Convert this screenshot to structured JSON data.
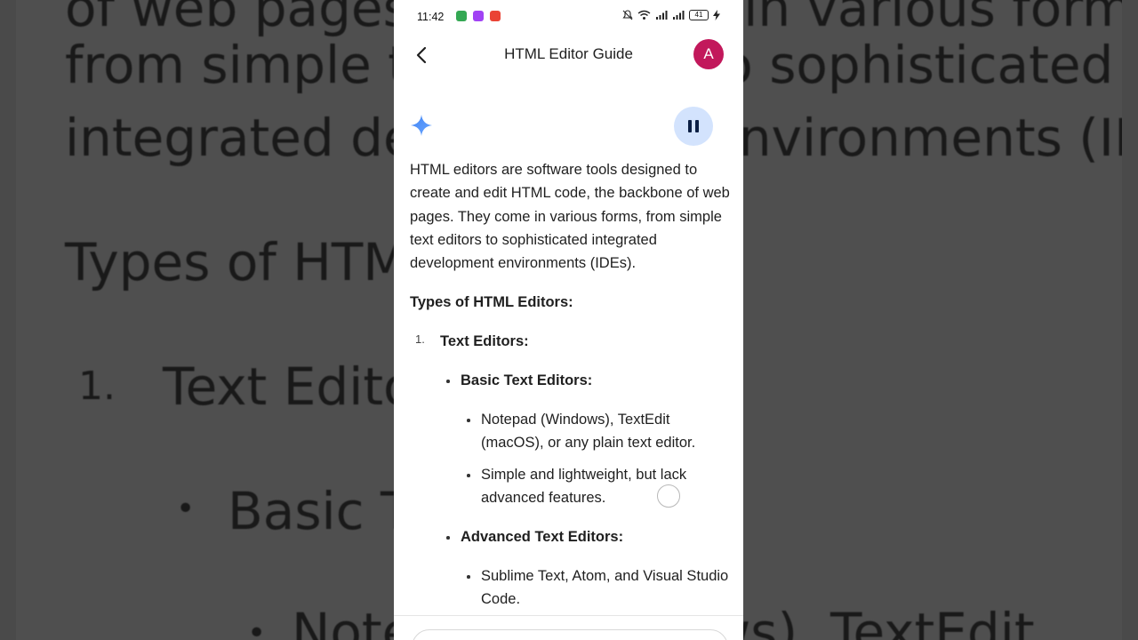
{
  "background": {
    "lines": [
      "of web pages. They come in various forms,",
      "from simple text editors to sophisticated",
      "integrated development environments (IDEs).",
      "Types of HTML Editors:",
      "1.",
      "Text Editors:",
      "•",
      "Basic Text Editors:",
      "•",
      "Notepad (Windows), TextEdit"
    ]
  },
  "status_bar": {
    "time": "11:42",
    "battery": "41"
  },
  "app_bar": {
    "title": "HTML Editor Guide",
    "avatar_letter": "A"
  },
  "article": {
    "intro": "HTML editors are software tools designed to create and edit HTML code, the backbone of web pages. They come in various forms, from simple text editors to sophisticated integrated development environments (IDEs).",
    "heading": "Types of HTML Editors:",
    "list": [
      {
        "number": "1.",
        "title": "Text Editors:",
        "groups": [
          {
            "title": "Basic Text Editors:",
            "items": [
              "Notepad (Windows), TextEdit (macOS), or any plain text editor.",
              "Simple and lightweight, but lack advanced features."
            ]
          },
          {
            "title": "Advanced Text Editors:",
            "items": [
              "Sublime Text, Atom, and Visual Studio Code."
            ]
          }
        ]
      }
    ]
  },
  "colors": {
    "avatar": "#c2185b",
    "pause_bg": "#d3e3fd",
    "spark": "#4285f4"
  }
}
